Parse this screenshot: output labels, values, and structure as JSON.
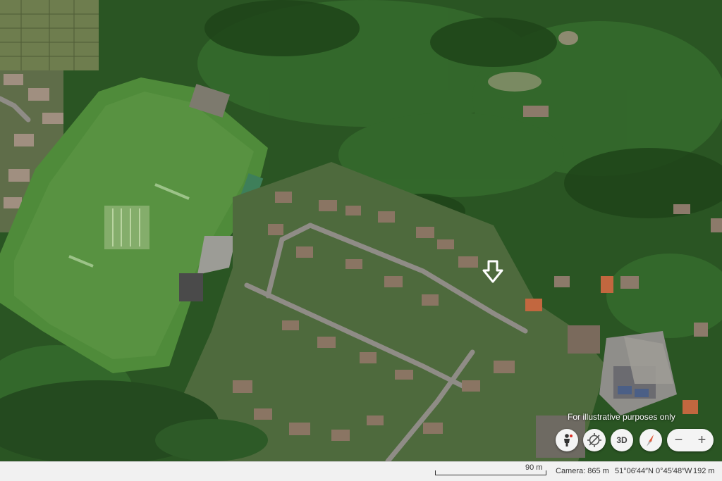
{
  "map": {
    "overlay_note": "For illustrative purposes only",
    "marker_icon": "down-arrow-marker-icon"
  },
  "controls": {
    "pegman_icon": "person-icon",
    "compass_icon": "compass-icon",
    "three_d_label": "3D",
    "north_icon": "north-arrow-icon",
    "zoom_out_label": "−",
    "zoom_in_label": "+"
  },
  "status": {
    "scale_label": "90 m",
    "camera": "Camera: 865 m",
    "coordinates": "51°06′44″N 0°45′48″W",
    "elevation": "192 m"
  },
  "colors": {
    "forest": "#2b5a26",
    "field": "#4f8a3a",
    "tennis_court": "#b8543a",
    "statusbar": "#f1f1f1"
  }
}
